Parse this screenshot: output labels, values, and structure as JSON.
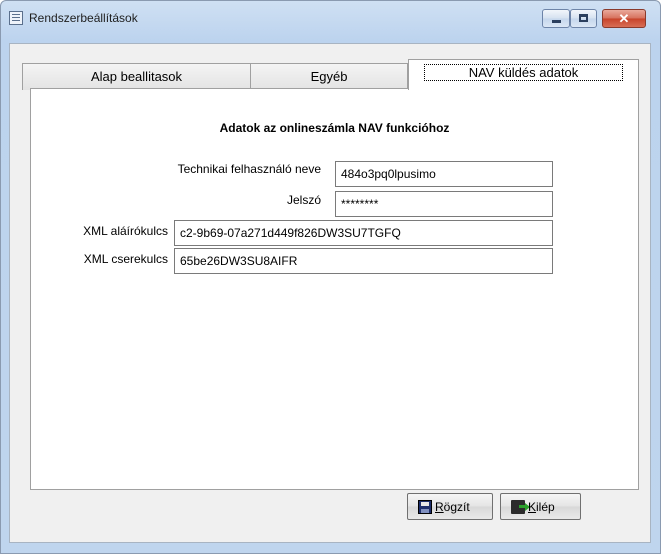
{
  "window": {
    "title": "Rendszerbeállítások"
  },
  "caption_buttons": {
    "close_glyph": "✕"
  },
  "tabs": [
    {
      "label": "Alap beallitasok",
      "active": false
    },
    {
      "label": "Egyéb",
      "active": false
    },
    {
      "label": "NAV küldés adatok",
      "active": true
    }
  ],
  "panel": {
    "heading": "Adatok az onlineszámla NAV funkcióhoz",
    "fields": {
      "user": {
        "label": "Technikai felhasználó neve",
        "value": "484o3pq0lpusimo"
      },
      "password": {
        "label": "Jelszó",
        "value": "********"
      },
      "sign_key": {
        "label": "XML aláírókulcs",
        "value": "c2-9b69-07a271d449f826DW3SU7TGFQ"
      },
      "exchange_key": {
        "label": "XML cserekulcs",
        "value": "65be26DW3SU8AIFR"
      }
    }
  },
  "buttons": {
    "save_label": "Rögzít",
    "exit_label": "Kilép"
  }
}
